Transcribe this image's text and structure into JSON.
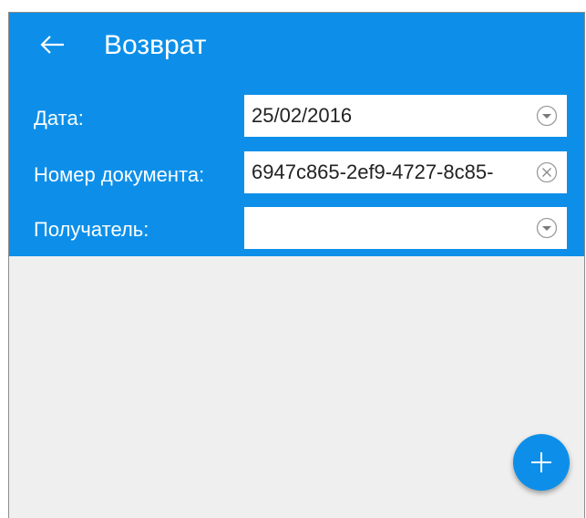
{
  "header": {
    "title": "Возврат",
    "back_icon": "arrow-left-icon",
    "background_color": "#0d8fe9"
  },
  "form": {
    "date": {
      "label": "Дата:",
      "value": "25/02/2016",
      "icon": "dropdown-circle-icon"
    },
    "document_number": {
      "label": "Номер документа:",
      "value": "6947c865-2ef9-4727-8c85-",
      "icon": "clear-circle-icon"
    },
    "recipient": {
      "label": "Получатель:",
      "value": "",
      "icon": "dropdown-circle-icon"
    }
  },
  "fab": {
    "icon": "plus-icon",
    "color": "#0d8fe9"
  }
}
